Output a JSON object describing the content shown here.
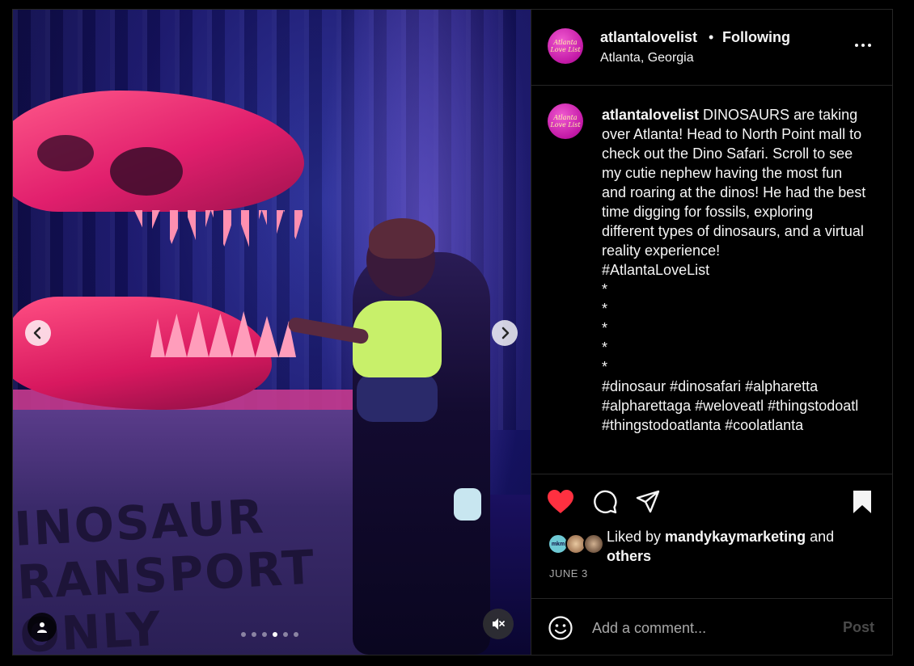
{
  "post": {
    "username": "atlantalovelist",
    "separator": "•",
    "follow_status": "Following",
    "location": "Atlanta, Georgia",
    "avatar_text": "Atlanta Love List",
    "caption_user": "atlantalovelist",
    "caption_text": " DINOSAURS are taking over Atlanta! Head to North Point mall to check out the Dino Safari. Scroll to see my cutie nephew having the most fun and roaring at the dinos! He had the best time digging for fossils, exploring different types of dinosaurs, and a virtual reality experience!\n#AtlantaLoveList\n*\n*\n*\n*\n*\n#dinosaur #dinosafari #alpharetta #alpharettaga #weloveatl #thingstodoatl #thingstodoatlanta #coolatlanta",
    "liked_by_prefix": "Liked by ",
    "liked_by_user": "mandykaymarketing",
    "liked_by_and": " and",
    "liked_by_others": "others",
    "liker_avatar_text": "mkm",
    "date": "JUNE 3"
  },
  "media": {
    "crate_text": "INOSAUR\nRANSPORT\nONLY",
    "carousel_count": 6,
    "carousel_active_index": 3
  },
  "comment": {
    "placeholder": "Add a comment...",
    "post_label": "Post"
  },
  "icons": {
    "prev": "chevron-left-icon",
    "next": "chevron-right-icon",
    "like": "heart-icon",
    "comment": "comment-icon",
    "share": "share-icon",
    "save": "bookmark-icon",
    "more": "more-icon",
    "emoji": "emoji-icon",
    "tag": "user-tag-icon",
    "mute": "muted-speaker-icon"
  },
  "colors": {
    "like_red": "#ff3040",
    "muted_text": "#a8a8a8",
    "avatar_pink": "#c218a6"
  }
}
